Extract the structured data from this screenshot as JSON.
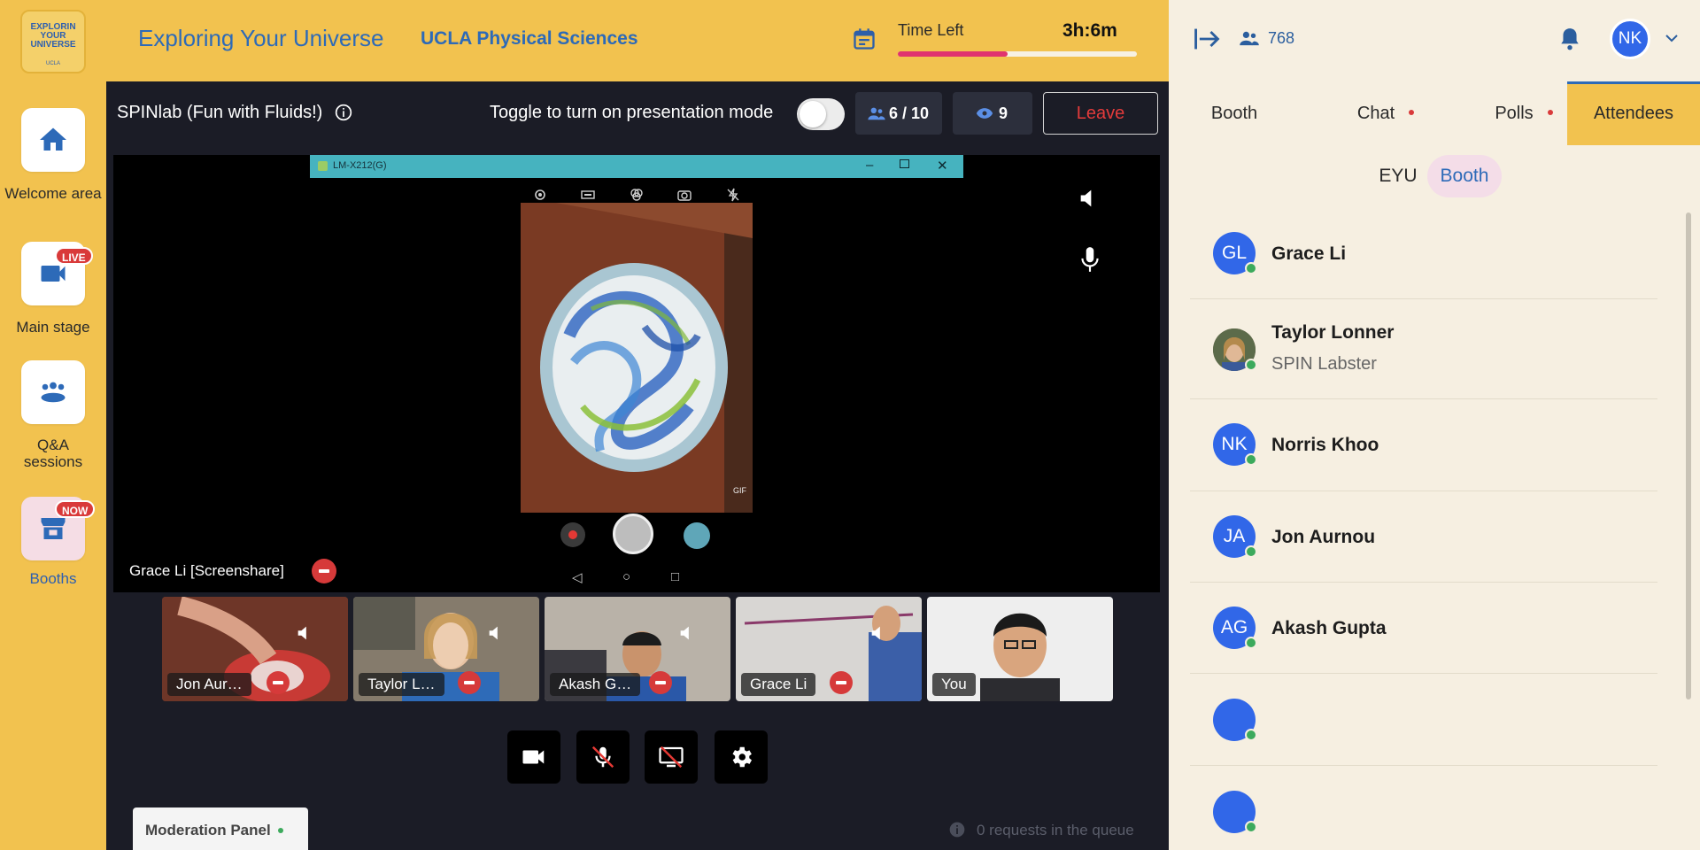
{
  "sidebar": {
    "logo_text": "EXPLORIN YOUR UNIVERSE",
    "logo_sub": "UCLA",
    "items": [
      {
        "label": "Welcome area",
        "icon": "home-icon"
      },
      {
        "label": "Main stage",
        "icon": "video-camera-icon",
        "badge": "LIVE"
      },
      {
        "label": "Q&A sessions",
        "icon": "group-icon"
      },
      {
        "label": "Booths",
        "icon": "booth-icon",
        "badge": "NOW"
      }
    ]
  },
  "header": {
    "title": "Exploring Your Universe",
    "subtitle": "UCLA Physical Sciences",
    "time_left_label": "Time Left",
    "time_left_value": "3h:6m",
    "time_progress": 0.46
  },
  "session": {
    "title": "SPINlab (Fun with Fluids!)",
    "toggle_label": "Toggle to turn on presentation mode",
    "participants": "6 / 10",
    "viewers": "9",
    "leave_label": "Leave"
  },
  "screenshare": {
    "window_title": "LM-X212(G)",
    "label": "Grace Li [Screenshare]",
    "gif_label": "GIF"
  },
  "thumbnails": [
    {
      "name": "Jon Aur…"
    },
    {
      "name": "Taylor L…"
    },
    {
      "name": "Akash G…"
    },
    {
      "name": "Grace Li"
    },
    {
      "name": "You"
    }
  ],
  "controls": [
    "camera-icon",
    "mic-muted-icon",
    "screenshare-off-icon",
    "gear-icon"
  ],
  "moderation": {
    "label": "Moderation Panel",
    "queue_text": "0 requests in the queue"
  },
  "right_panel": {
    "attendee_count": "768",
    "user_initials": "NK",
    "tabs": [
      {
        "label": "Booth"
      },
      {
        "label": "Chat",
        "has_dot": true
      },
      {
        "label": "Polls",
        "has_dot": true
      },
      {
        "label": "Attendees",
        "active": true
      }
    ],
    "sub_tabs": [
      {
        "label": "EYU"
      },
      {
        "label": "Booth",
        "active": true
      }
    ],
    "attendees": [
      {
        "initials": "GL",
        "name": "Grace Li",
        "subtitle": ""
      },
      {
        "initials": "",
        "name": "Taylor Lonner",
        "subtitle": "SPIN Labster"
      },
      {
        "initials": "NK",
        "name": "Norris Khoo",
        "subtitle": ""
      },
      {
        "initials": "JA",
        "name": "Jon Aurnou",
        "subtitle": ""
      },
      {
        "initials": "AG",
        "name": "Akash Gupta",
        "subtitle": ""
      },
      {
        "initials": "",
        "name": "",
        "subtitle": ""
      },
      {
        "initials": "",
        "name": "",
        "subtitle": ""
      }
    ]
  },
  "colors": {
    "brand_yellow": "#f2c24f",
    "brand_blue": "#2d6ab8",
    "dark_bg": "#1b1c26",
    "panel_bg": "#f6efe1",
    "avatar_blue": "#3167e8",
    "alert_red": "#d93a3a",
    "online_green": "#3caa5c"
  }
}
